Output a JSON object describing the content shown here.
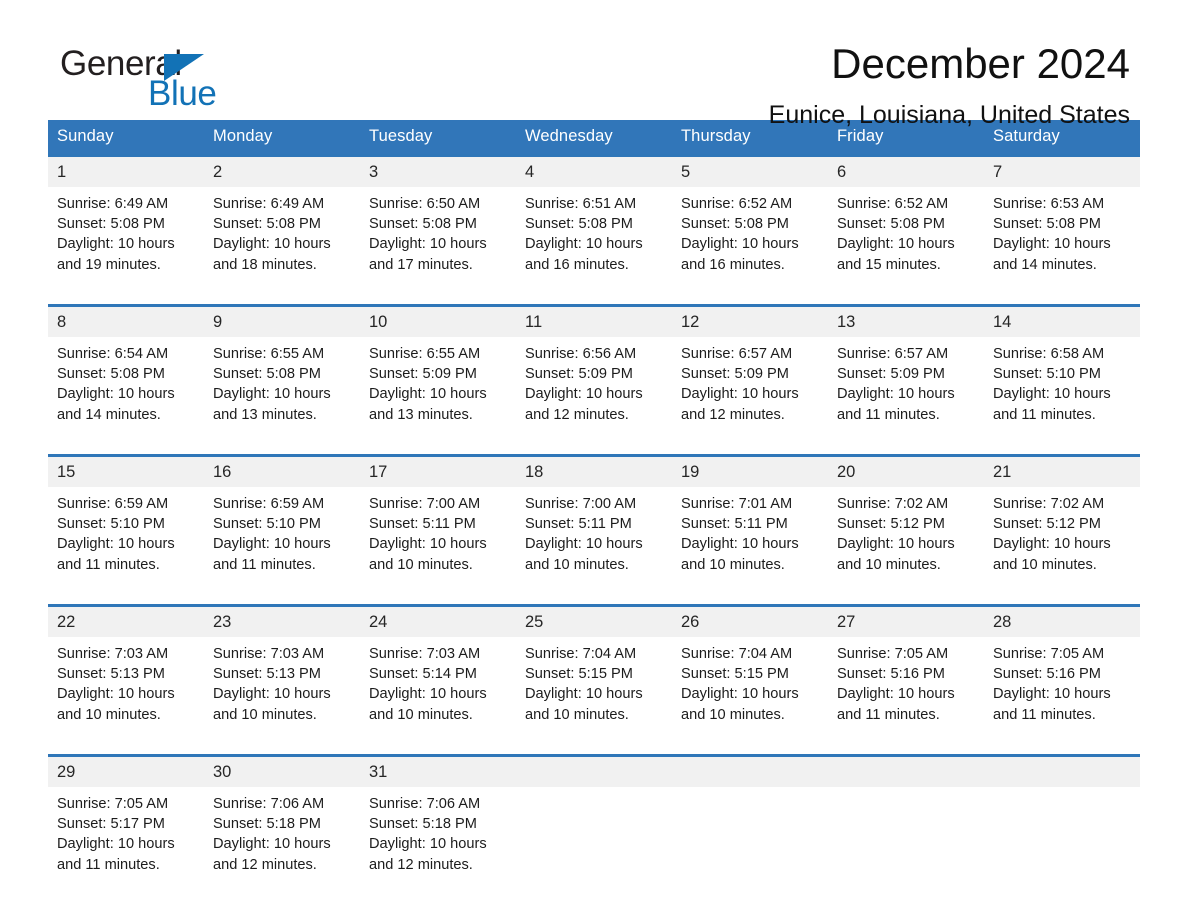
{
  "brand": {
    "name_part1": "General",
    "name_part2": "Blue",
    "triangle_color": "#1272b6"
  },
  "header": {
    "title": "December 2024",
    "location": "Eunice, Louisiana, United States",
    "header_bg_color": "#3176b9",
    "row_border_color": "#2f76b8",
    "daynum_bg_color": "#f1f1f1"
  },
  "weekdays": [
    "Sunday",
    "Monday",
    "Tuesday",
    "Wednesday",
    "Thursday",
    "Friday",
    "Saturday"
  ],
  "weeks": [
    {
      "days": [
        {
          "num": "1",
          "sunrise": "Sunrise: 6:49 AM",
          "sunset": "Sunset: 5:08 PM",
          "daylight1": "Daylight: 10 hours",
          "daylight2": "and 19 minutes."
        },
        {
          "num": "2",
          "sunrise": "Sunrise: 6:49 AM",
          "sunset": "Sunset: 5:08 PM",
          "daylight1": "Daylight: 10 hours",
          "daylight2": "and 18 minutes."
        },
        {
          "num": "3",
          "sunrise": "Sunrise: 6:50 AM",
          "sunset": "Sunset: 5:08 PM",
          "daylight1": "Daylight: 10 hours",
          "daylight2": "and 17 minutes."
        },
        {
          "num": "4",
          "sunrise": "Sunrise: 6:51 AM",
          "sunset": "Sunset: 5:08 PM",
          "daylight1": "Daylight: 10 hours",
          "daylight2": "and 16 minutes."
        },
        {
          "num": "5",
          "sunrise": "Sunrise: 6:52 AM",
          "sunset": "Sunset: 5:08 PM",
          "daylight1": "Daylight: 10 hours",
          "daylight2": "and 16 minutes."
        },
        {
          "num": "6",
          "sunrise": "Sunrise: 6:52 AM",
          "sunset": "Sunset: 5:08 PM",
          "daylight1": "Daylight: 10 hours",
          "daylight2": "and 15 minutes."
        },
        {
          "num": "7",
          "sunrise": "Sunrise: 6:53 AM",
          "sunset": "Sunset: 5:08 PM",
          "daylight1": "Daylight: 10 hours",
          "daylight2": "and 14 minutes."
        }
      ]
    },
    {
      "days": [
        {
          "num": "8",
          "sunrise": "Sunrise: 6:54 AM",
          "sunset": "Sunset: 5:08 PM",
          "daylight1": "Daylight: 10 hours",
          "daylight2": "and 14 minutes."
        },
        {
          "num": "9",
          "sunrise": "Sunrise: 6:55 AM",
          "sunset": "Sunset: 5:08 PM",
          "daylight1": "Daylight: 10 hours",
          "daylight2": "and 13 minutes."
        },
        {
          "num": "10",
          "sunrise": "Sunrise: 6:55 AM",
          "sunset": "Sunset: 5:09 PM",
          "daylight1": "Daylight: 10 hours",
          "daylight2": "and 13 minutes."
        },
        {
          "num": "11",
          "sunrise": "Sunrise: 6:56 AM",
          "sunset": "Sunset: 5:09 PM",
          "daylight1": "Daylight: 10 hours",
          "daylight2": "and 12 minutes."
        },
        {
          "num": "12",
          "sunrise": "Sunrise: 6:57 AM",
          "sunset": "Sunset: 5:09 PM",
          "daylight1": "Daylight: 10 hours",
          "daylight2": "and 12 minutes."
        },
        {
          "num": "13",
          "sunrise": "Sunrise: 6:57 AM",
          "sunset": "Sunset: 5:09 PM",
          "daylight1": "Daylight: 10 hours",
          "daylight2": "and 11 minutes."
        },
        {
          "num": "14",
          "sunrise": "Sunrise: 6:58 AM",
          "sunset": "Sunset: 5:10 PM",
          "daylight1": "Daylight: 10 hours",
          "daylight2": "and 11 minutes."
        }
      ]
    },
    {
      "days": [
        {
          "num": "15",
          "sunrise": "Sunrise: 6:59 AM",
          "sunset": "Sunset: 5:10 PM",
          "daylight1": "Daylight: 10 hours",
          "daylight2": "and 11 minutes."
        },
        {
          "num": "16",
          "sunrise": "Sunrise: 6:59 AM",
          "sunset": "Sunset: 5:10 PM",
          "daylight1": "Daylight: 10 hours",
          "daylight2": "and 11 minutes."
        },
        {
          "num": "17",
          "sunrise": "Sunrise: 7:00 AM",
          "sunset": "Sunset: 5:11 PM",
          "daylight1": "Daylight: 10 hours",
          "daylight2": "and 10 minutes."
        },
        {
          "num": "18",
          "sunrise": "Sunrise: 7:00 AM",
          "sunset": "Sunset: 5:11 PM",
          "daylight1": "Daylight: 10 hours",
          "daylight2": "and 10 minutes."
        },
        {
          "num": "19",
          "sunrise": "Sunrise: 7:01 AM",
          "sunset": "Sunset: 5:11 PM",
          "daylight1": "Daylight: 10 hours",
          "daylight2": "and 10 minutes."
        },
        {
          "num": "20",
          "sunrise": "Sunrise: 7:02 AM",
          "sunset": "Sunset: 5:12 PM",
          "daylight1": "Daylight: 10 hours",
          "daylight2": "and 10 minutes."
        },
        {
          "num": "21",
          "sunrise": "Sunrise: 7:02 AM",
          "sunset": "Sunset: 5:12 PM",
          "daylight1": "Daylight: 10 hours",
          "daylight2": "and 10 minutes."
        }
      ]
    },
    {
      "days": [
        {
          "num": "22",
          "sunrise": "Sunrise: 7:03 AM",
          "sunset": "Sunset: 5:13 PM",
          "daylight1": "Daylight: 10 hours",
          "daylight2": "and 10 minutes."
        },
        {
          "num": "23",
          "sunrise": "Sunrise: 7:03 AM",
          "sunset": "Sunset: 5:13 PM",
          "daylight1": "Daylight: 10 hours",
          "daylight2": "and 10 minutes."
        },
        {
          "num": "24",
          "sunrise": "Sunrise: 7:03 AM",
          "sunset": "Sunset: 5:14 PM",
          "daylight1": "Daylight: 10 hours",
          "daylight2": "and 10 minutes."
        },
        {
          "num": "25",
          "sunrise": "Sunrise: 7:04 AM",
          "sunset": "Sunset: 5:15 PM",
          "daylight1": "Daylight: 10 hours",
          "daylight2": "and 10 minutes."
        },
        {
          "num": "26",
          "sunrise": "Sunrise: 7:04 AM",
          "sunset": "Sunset: 5:15 PM",
          "daylight1": "Daylight: 10 hours",
          "daylight2": "and 10 minutes."
        },
        {
          "num": "27",
          "sunrise": "Sunrise: 7:05 AM",
          "sunset": "Sunset: 5:16 PM",
          "daylight1": "Daylight: 10 hours",
          "daylight2": "and 11 minutes."
        },
        {
          "num": "28",
          "sunrise": "Sunrise: 7:05 AM",
          "sunset": "Sunset: 5:16 PM",
          "daylight1": "Daylight: 10 hours",
          "daylight2": "and 11 minutes."
        }
      ]
    },
    {
      "days": [
        {
          "num": "29",
          "sunrise": "Sunrise: 7:05 AM",
          "sunset": "Sunset: 5:17 PM",
          "daylight1": "Daylight: 10 hours",
          "daylight2": "and 11 minutes."
        },
        {
          "num": "30",
          "sunrise": "Sunrise: 7:06 AM",
          "sunset": "Sunset: 5:18 PM",
          "daylight1": "Daylight: 10 hours",
          "daylight2": "and 12 minutes."
        },
        {
          "num": "31",
          "sunrise": "Sunrise: 7:06 AM",
          "sunset": "Sunset: 5:18 PM",
          "daylight1": "Daylight: 10 hours",
          "daylight2": "and 12 minutes."
        },
        {
          "num": "",
          "sunrise": "",
          "sunset": "",
          "daylight1": "",
          "daylight2": ""
        },
        {
          "num": "",
          "sunrise": "",
          "sunset": "",
          "daylight1": "",
          "daylight2": ""
        },
        {
          "num": "",
          "sunrise": "",
          "sunset": "",
          "daylight1": "",
          "daylight2": ""
        },
        {
          "num": "",
          "sunrise": "",
          "sunset": "",
          "daylight1": "",
          "daylight2": ""
        }
      ]
    }
  ]
}
